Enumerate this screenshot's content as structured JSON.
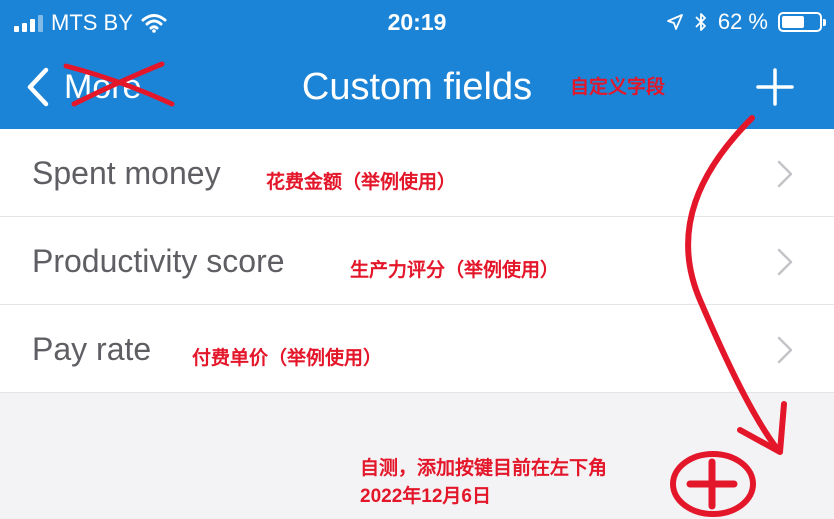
{
  "status_bar": {
    "carrier": "MTS BY",
    "time": "20:19",
    "battery_percent": "62 %",
    "battery_level": 0.62,
    "icons": [
      "signal-bars-icon",
      "wifi-icon",
      "location-arrow-icon",
      "bluetooth-icon",
      "battery-icon"
    ]
  },
  "nav": {
    "back_label": "More",
    "title": "Custom fields",
    "title_note": "自定义字段",
    "add_icon": "plus-icon"
  },
  "fields": [
    {
      "label": "Spent money",
      "note": "花费金额（举例使用）"
    },
    {
      "label": "Productivity score",
      "note": "生产力评分（举例使用）"
    },
    {
      "label": "Pay rate",
      "note": "付费单价（举例使用）"
    }
  ],
  "annotation": {
    "line1": "自测，添加按键目前在左下角",
    "line2": "2022年12月6日"
  },
  "colors": {
    "header": "#1c84d6",
    "background": "#f3f3f5",
    "annotation_red": "#e4162a"
  }
}
